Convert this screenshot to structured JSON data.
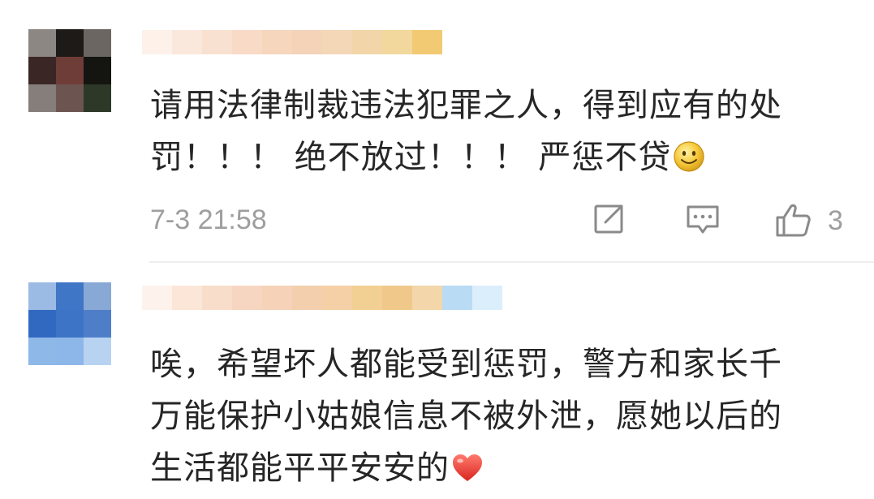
{
  "comments": [
    {
      "text_lines": [
        "请用法律制裁违法犯罪之人，得到应有的处",
        "罚！！！ 绝不放过！！！ 严惩不贷"
      ],
      "trailing_emoji": "smiley-emoji",
      "timestamp": "7-3 21:58",
      "like_count": "3",
      "avatar_colors": [
        "#8d8783",
        "#1e1a17",
        "#6b6661",
        "#3a2624",
        "#6f3d38",
        "#141510",
        "#857e7b",
        "#6c5551",
        "#2d3828"
      ],
      "username_colors": [
        "#fdf1ea",
        "#fbe8dc",
        "#f8e1d1",
        "#f8dac7",
        "#f6d6bd",
        "#f4d3b9",
        "#f3d7b6",
        "#f2d6a9",
        "#f3d89d",
        "#f1ca73"
      ]
    },
    {
      "text_lines": [
        "唉，希望坏人都能受到惩罚，警方和家长千",
        "万能保护小姑娘信息不被外泄，愿她以后的",
        "生活都能平平安安的"
      ],
      "trailing_emoji": "heart-emoji",
      "avatar_colors": [
        "#9cbbe4",
        "#3f76c5",
        "#88a8d6",
        "#3169c1",
        "#3d74c6",
        "#4f7ec9",
        "#8eb8e8",
        "#8eb7e9",
        "#b7d3f1"
      ],
      "username_colors": [
        "#fdf3ec",
        "#fbe6d8",
        "#f8ddca",
        "#f6d6c0",
        "#f5d2b8",
        "#f4cfae",
        "#f5d0a6",
        "#f2cf93",
        "#f0c98a",
        "#f3d7aa",
        "#b9dbf4",
        "#dbeefb"
      ]
    }
  ],
  "icons": {
    "repost": "share-edit-icon",
    "reply": "comment-icon",
    "like": "thumbs-up-icon"
  },
  "colors": {
    "text": "#262626",
    "meta": "#9e9e9e",
    "divider": "#eeeeee",
    "heart": "#e8413c",
    "smiley": "#f6c93a"
  }
}
